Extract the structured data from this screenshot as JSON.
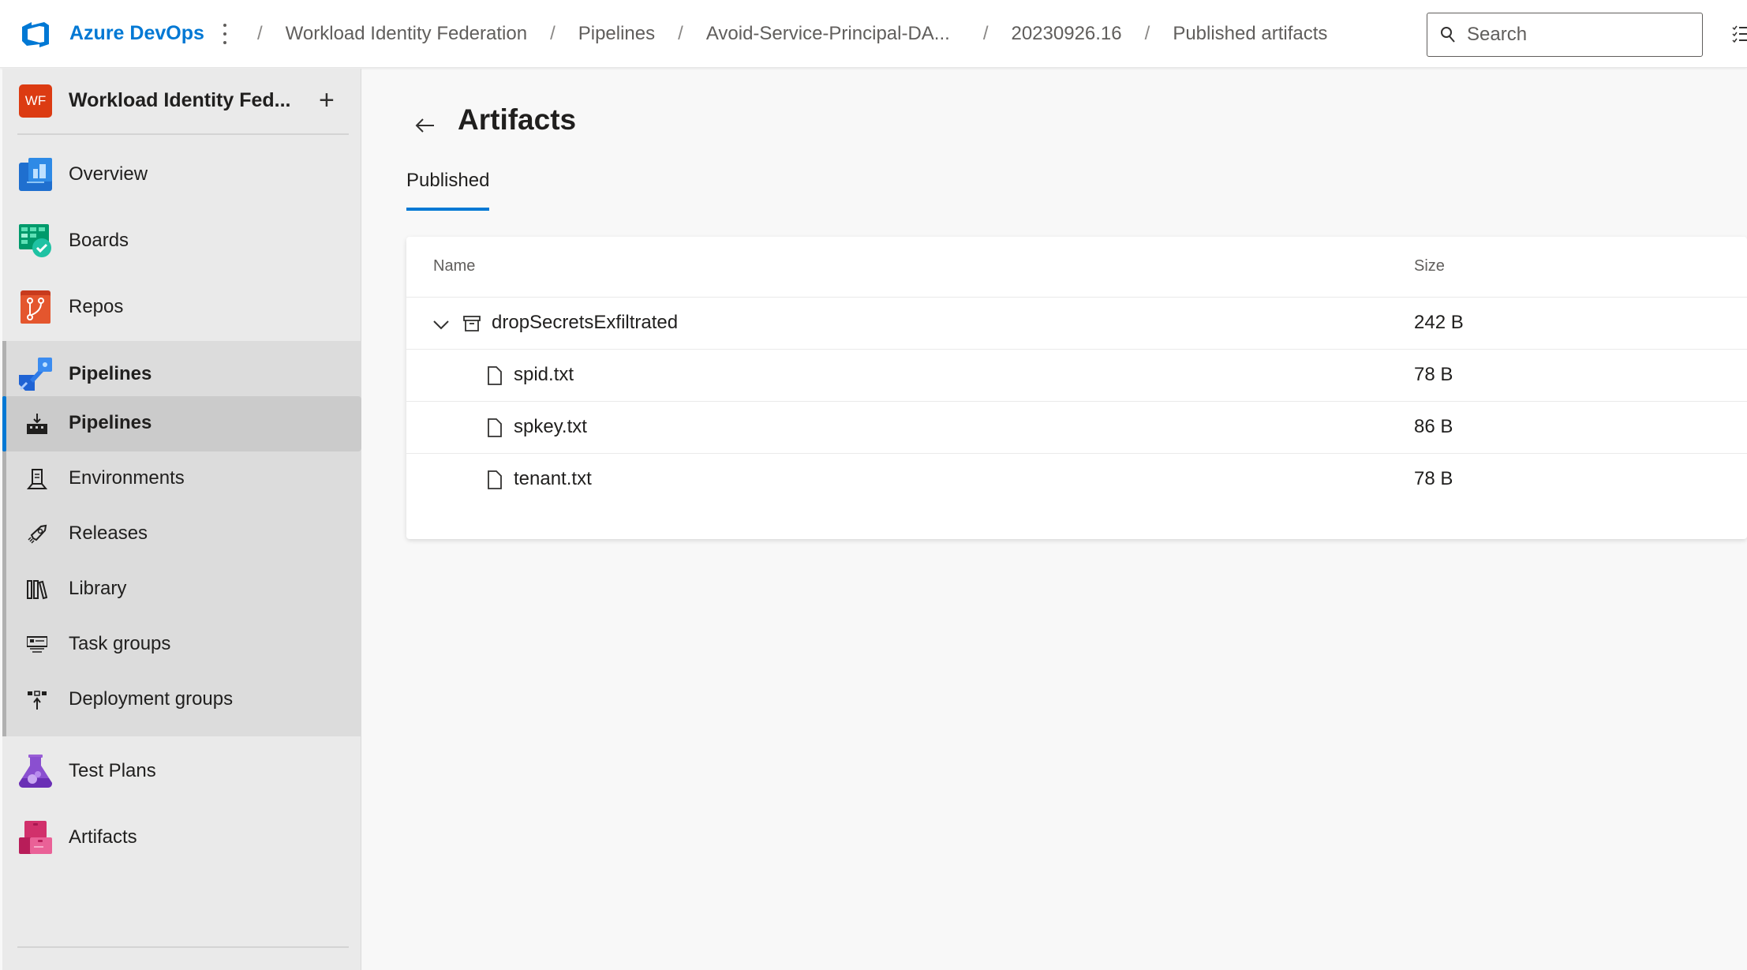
{
  "header": {
    "brand": "Azure DevOps",
    "breadcrumbs": [
      {
        "label": "Workload Identity Federation"
      },
      {
        "label": "Pipelines"
      },
      {
        "label": "Avoid-Service-Principal-DA..."
      },
      {
        "label": "20230926.16"
      },
      {
        "label": "Published artifacts"
      }
    ],
    "separator": "/",
    "search": {
      "placeholder": "Search",
      "value": ""
    },
    "icons": {
      "logo": "azure-devops-logo",
      "more": "more-vertical-icon",
      "search": "search-icon",
      "tasks": "task-list-icon"
    }
  },
  "sidebar": {
    "project": {
      "initials": "WF",
      "name": "Workload Identity Fed...",
      "add_label": "+"
    },
    "items": [
      {
        "label": "Overview",
        "icon": "overview-icon"
      },
      {
        "label": "Boards",
        "icon": "boards-icon"
      },
      {
        "label": "Repos",
        "icon": "repos-icon"
      },
      {
        "label": "Pipelines",
        "icon": "pipelines-icon"
      },
      {
        "label": "Test Plans",
        "icon": "test-plans-icon"
      },
      {
        "label": "Artifacts",
        "icon": "artifacts-icon"
      }
    ],
    "pipelines_subitems": [
      {
        "label": "Pipelines",
        "icon": "pipelines-sub-icon",
        "active": true
      },
      {
        "label": "Environments",
        "icon": "environments-icon"
      },
      {
        "label": "Releases",
        "icon": "releases-icon"
      },
      {
        "label": "Library",
        "icon": "library-icon"
      },
      {
        "label": "Task groups",
        "icon": "task-groups-icon"
      },
      {
        "label": "Deployment groups",
        "icon": "deployment-groups-icon"
      }
    ]
  },
  "main": {
    "title": "Artifacts",
    "tabs": [
      {
        "label": "Published",
        "selected": true
      }
    ],
    "table": {
      "columns": [
        "Name",
        "Size"
      ],
      "rows": [
        {
          "name": "dropSecretsExfiltrated",
          "size": "242 B",
          "type": "artifact",
          "expanded": true
        },
        {
          "name": "spid.txt",
          "size": "78 B",
          "type": "file"
        },
        {
          "name": "spkey.txt",
          "size": "86 B",
          "type": "file"
        },
        {
          "name": "tenant.txt",
          "size": "78 B",
          "type": "file"
        }
      ]
    }
  },
  "colors": {
    "accent": "#0078d4",
    "project_badge": "#dc3b12",
    "sidebar_bg": "#eaeaea",
    "group_bg": "#dcdcdc",
    "active_bg": "#cbcbcb"
  }
}
